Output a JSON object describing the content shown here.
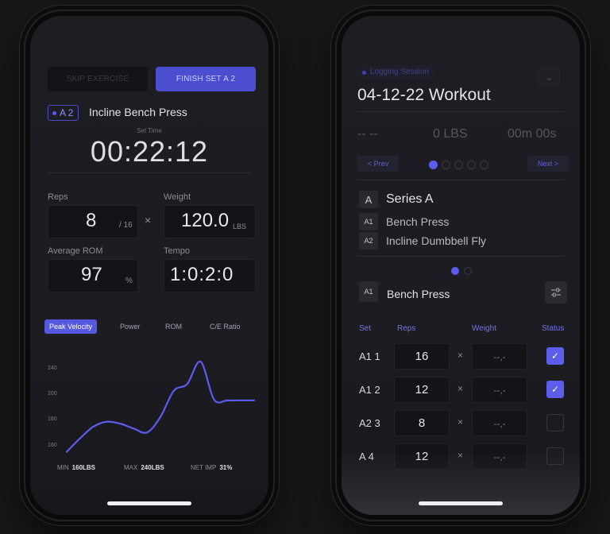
{
  "left": {
    "skip_label": "SKIP EXERCISE",
    "finish_label": "FINISH SET A 2",
    "exercise_tag": "A 2",
    "exercise_name": "Incline Bench Press",
    "set_time_label": "Set Time",
    "set_time": "00:22:12",
    "reps_label": "Reps",
    "reps_value": "8",
    "reps_total": "/ 16",
    "times_symbol": "×",
    "weight_label": "Weight",
    "weight_value": "120.0",
    "weight_unit": "LBS",
    "rom_label": "Average ROM",
    "rom_value": "97",
    "rom_unit": "%",
    "tempo_label": "Tempo",
    "tempo_value": "1:0:2:0",
    "tabs": [
      "Peak Velocity",
      "Power",
      "ROM",
      "C/E Ratio"
    ],
    "active_tab": "Peak Velocity",
    "accent": "#5659e0",
    "stats": {
      "min_label": "MIN",
      "min_value": "160LBS",
      "max_label": "MAX",
      "max_value": "240LBS",
      "net_label": "NET IMP",
      "net_value": "31%"
    }
  },
  "chart_data": {
    "type": "line",
    "title": "",
    "xlabel": "",
    "ylabel": "",
    "yticks": [
      "240",
      "200",
      "180",
      "160"
    ],
    "ylim": [
      150,
      250
    ],
    "x": [
      0,
      1,
      2,
      3,
      4,
      5,
      6,
      7,
      8,
      9,
      10,
      11,
      12,
      13,
      14
    ],
    "series": [
      {
        "values": [
          152,
          166,
          178,
          183,
          181,
          176,
          172,
          188,
          215,
          222,
          245,
          206,
          205,
          205,
          205
        ],
        "color": "#5a5df0"
      }
    ]
  },
  "right": {
    "status_label": "Logging Session",
    "workout_title": "04-12-22 Workout",
    "stat_duration": "-- --",
    "stat_weight": "0 LBS",
    "stat_time": "00m 00s",
    "prev_label": "< Prev",
    "next_label": "Next >",
    "series_badge": "A",
    "series_title": "Series A",
    "series_items": [
      {
        "code": "A1",
        "name": "Bench Press"
      },
      {
        "code": "A2",
        "name": "Incline Dumbbell Fly"
      }
    ],
    "current_code": "A1",
    "current_name": "Bench Press",
    "table_headers": {
      "set": "Set",
      "reps": "Reps",
      "weight": "Weight",
      "status": "Status"
    },
    "rows": [
      {
        "set": "A1 1",
        "reps": "16",
        "weight": "--,-",
        "done": true
      },
      {
        "set": "A1 2",
        "reps": "12",
        "weight": "--,-",
        "done": true
      },
      {
        "set": "A2 3",
        "reps": "8",
        "weight": "--,-",
        "done": false
      },
      {
        "set": "A 4",
        "reps": "12",
        "weight": "--,-",
        "done": false
      }
    ],
    "times_symbol": "×",
    "check_glyph": "✓"
  }
}
